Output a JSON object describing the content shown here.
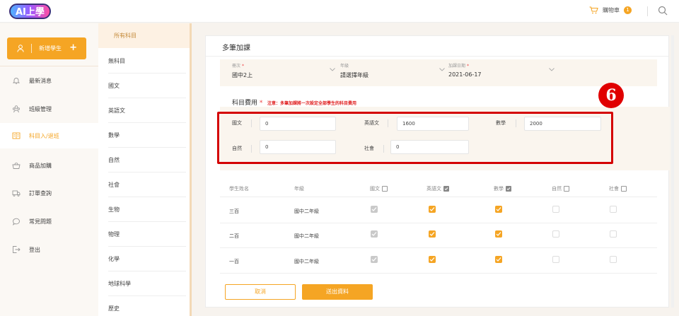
{
  "app": {
    "logo_text": "AI上學"
  },
  "topbar": {
    "cart_label": "購物車",
    "cart_count": "1"
  },
  "sidebar": {
    "new_student_label": "新增學生",
    "items": [
      {
        "label": "最新消息",
        "icon": "bell-icon"
      },
      {
        "label": "班級管理",
        "icon": "people-icon"
      },
      {
        "label": "科目入/退班",
        "icon": "book-icon"
      },
      {
        "label": "商品加購",
        "icon": "basket-icon"
      },
      {
        "label": "訂單查詢",
        "icon": "truck-icon"
      },
      {
        "label": "常見問題",
        "icon": "chat-icon"
      },
      {
        "label": "登出",
        "icon": "logout-icon"
      }
    ],
    "active_index": 2
  },
  "subjects": [
    "所有科目",
    "無科目",
    "國文",
    "英語文",
    "數學",
    "自然",
    "社會",
    "生物",
    "物理",
    "化學",
    "地球科學",
    "歷史"
  ],
  "panel": {
    "title": "多筆加課",
    "filters": [
      {
        "label": "冊次",
        "required": "*",
        "value": "國中2上"
      },
      {
        "label": "年級",
        "required": "",
        "value": "請選擇年級"
      },
      {
        "label": "加課日期",
        "required": "*",
        "value": "2021-06-17"
      }
    ],
    "fee_label": "科目費用",
    "fee_required": "*",
    "fee_note": "注意：多筆加課將一次設定全部學生的科目費用",
    "fees": [
      {
        "label": "國文",
        "value": "0"
      },
      {
        "label": "英語文",
        "value": "1600"
      },
      {
        "label": "數學",
        "value": "2000"
      },
      {
        "label": "自然",
        "value": "0"
      },
      {
        "label": "社會",
        "value": "0"
      }
    ],
    "step_number": "6",
    "table": {
      "headers": [
        "學生姓名",
        "年級",
        "國文",
        "英語文",
        "數學",
        "自然",
        "社會"
      ],
      "header_checked": [
        false,
        false,
        false,
        true,
        true,
        false,
        false
      ],
      "rows": [
        {
          "name": "三百",
          "grade": "國中二年級",
          "checks": [
            "dis",
            "on",
            "on",
            "off",
            "off"
          ]
        },
        {
          "name": "二百",
          "grade": "國中二年級",
          "checks": [
            "dis",
            "on",
            "on",
            "off",
            "off"
          ]
        },
        {
          "name": "一百",
          "grade": "國中二年級",
          "checks": [
            "dis",
            "on",
            "on",
            "off",
            "off"
          ]
        }
      ]
    },
    "cancel_label": "取消",
    "submit_label": "送出資料"
  },
  "colors": {
    "accent": "#f5a524",
    "highlight": "#d40000"
  }
}
